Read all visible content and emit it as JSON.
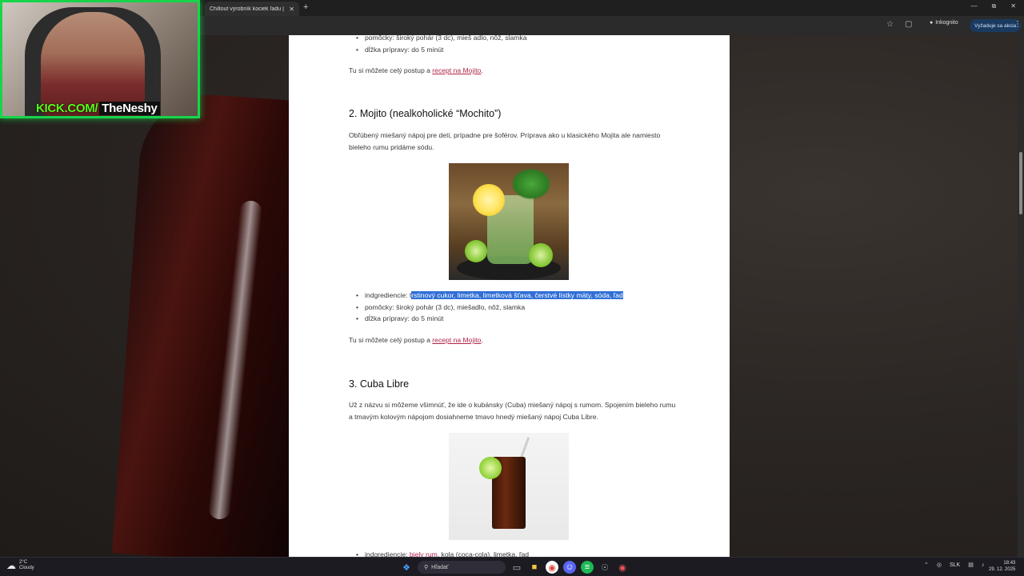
{
  "browser": {
    "tab_title": "Chillout výrobník kociek ľadu |",
    "tab_close": "✕",
    "new_tab": "+",
    "incognito_label": "Inkognito",
    "action_label": "Vyžaduje sa akcia"
  },
  "article": {
    "top_list": [
      "pomôcky: široký pohár (3 dc), mieš adlo, nôž, slamka",
      "dĺžka prípravy: do 5 minút"
    ],
    "top_outro_prefix": "Tu si môžete celý postup a ",
    "top_outro_link": "recept na Mojito",
    "top_outro_suffix": ".",
    "section2": {
      "heading": "2. Mojito (nealkoholické “Mochito”)",
      "intro": "Obľúbený miešaný nápoj pre deti, prípadne pre šoférov. Príprava ako u klasického Mojita ale namiesto bieleho rumu pridáme sódu.",
      "ingredients_label": "indgrediencie: t",
      "ingredients_selected": "rstinový cukor, limetka, limetková šťava, čerstvé lístky mäty, sóda, ľad",
      "tools": "pomôcky: široký pohár (3 dc), miešadlo, nôž, slamka",
      "time": "dĺžka prípravy: do 5 minút",
      "outro_prefix": "Tu si môžete celý postup a ",
      "outro_link": "recept na Mojito",
      "outro_suffix": "."
    },
    "section3": {
      "heading": "3. Cuba Libre",
      "intro": "Už z názvu si môžeme všimnúť, že ide o kubánsky (Cuba) miešaný nápoj s rumom. Spojením bieleho rumu a tmavým kolovým nápojom dosiahneme tmavo hnedý miešaný nápoj Cuba Libre.",
      "ingredients_prefix": "indgrediencie: ",
      "ingredients_link": "biely rum",
      "ingredients_rest": ", kola (coca-cola), limetka, ľad"
    }
  },
  "webcam": {
    "brand_site": "KICK.COM/",
    "brand_user": "TheNeshy"
  },
  "taskbar": {
    "weather_temp": "2°C",
    "weather_desc": "Cloudy",
    "search_placeholder": "Hľadať",
    "lang": "SLK",
    "time": "18:43",
    "date": "29. 12. 2025"
  },
  "colors": {
    "link": "#b0244a",
    "selection": "#2f6fd6",
    "webcam_border": "#17d44a",
    "kick_green": "#53fc18"
  }
}
